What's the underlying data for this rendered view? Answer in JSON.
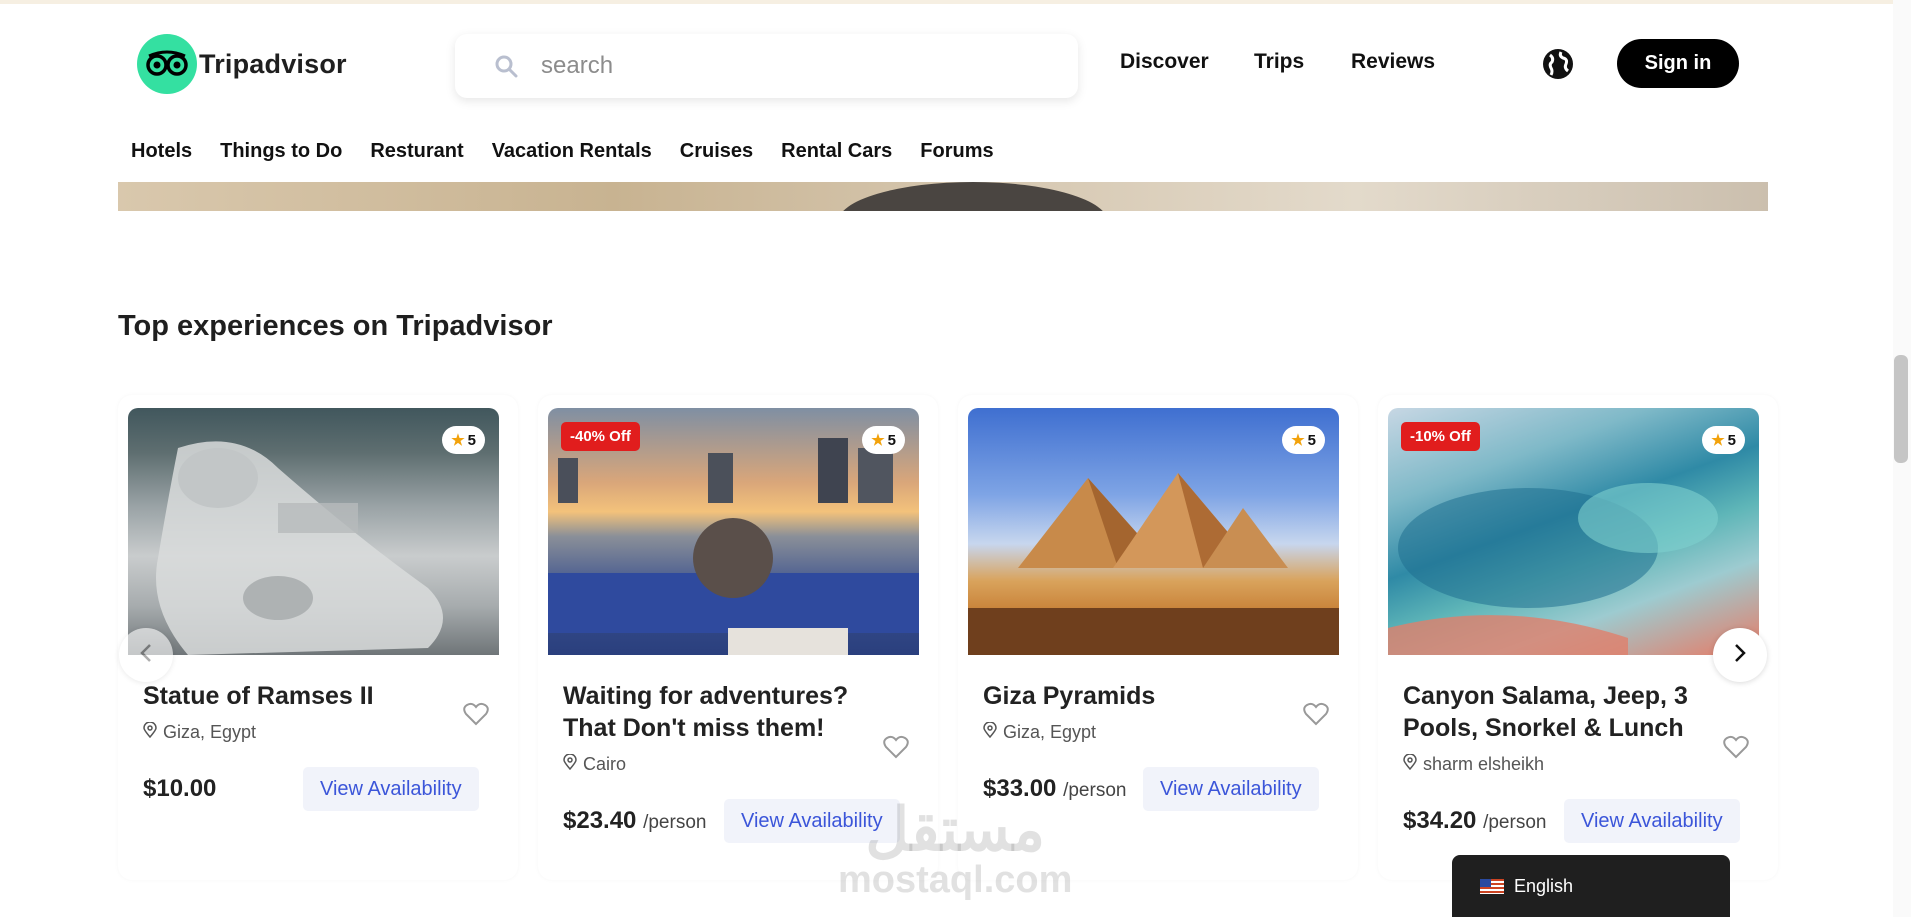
{
  "brand": {
    "name": "Tripadvisor"
  },
  "search": {
    "placeholder": "search"
  },
  "top_nav": [
    "Discover",
    "Trips",
    "Reviews"
  ],
  "header": {
    "signin_label": "Sign in"
  },
  "categories": [
    "Hotels",
    "Things to Do",
    "Resturant",
    "Vacation Rentals",
    "Cruises",
    "Rental Cars",
    "Forums"
  ],
  "section": {
    "title": "Top experiences on Tripadvisor"
  },
  "cards": [
    {
      "title": "Statue of Ramses II",
      "location": "Giza, Egypt",
      "price": "$10.00",
      "per": "",
      "rating": "5",
      "discount": "",
      "cta": "View Availability"
    },
    {
      "title": "Waiting for adventures? That Don't miss them!",
      "location": "Cairo",
      "price": "$23.40",
      "per": "/person",
      "rating": "5",
      "discount": "-40% Off",
      "cta": "View Availability"
    },
    {
      "title": "Giza Pyramids",
      "location": "Giza, Egypt",
      "price": "$33.00",
      "per": "/person",
      "rating": "5",
      "discount": "",
      "cta": "View Availability"
    },
    {
      "title": "Canyon Salama, Jeep, 3 Pools, Snorkel & Lunch",
      "location": "sharm elsheikh",
      "price": "$34.20",
      "per": "/person",
      "rating": "5",
      "discount": "-10% Off",
      "cta": "View Availability"
    }
  ],
  "language": {
    "label": "English"
  },
  "watermark": {
    "arabic": "مستقل",
    "latin": "mostaql.com"
  },
  "colors": {
    "brand_green": "#34e0a1",
    "signin_bg": "#000000",
    "discount_red": "#e11d1d",
    "cta_blue": "#3b55d9",
    "star": "#f2a20c"
  }
}
